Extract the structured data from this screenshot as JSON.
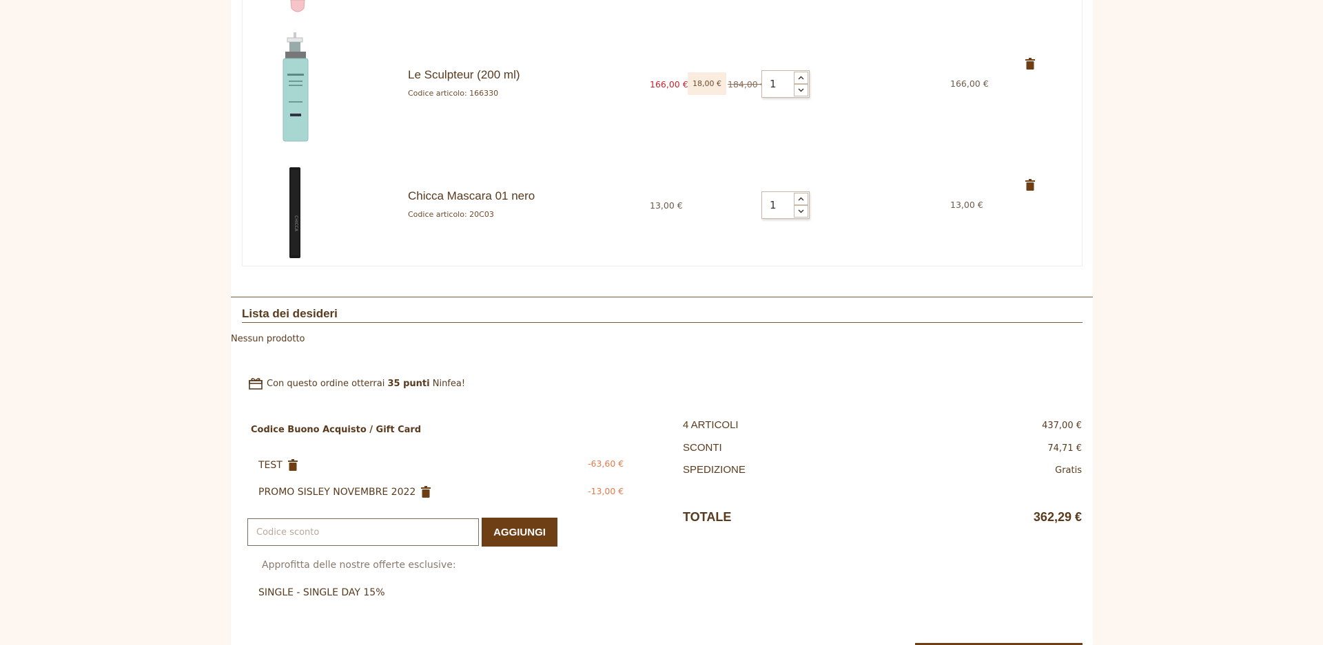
{
  "cart": {
    "items": [
      {
        "name": "Le Sculpteur (200 ml)",
        "code": "Codice articolo: 166330",
        "price_sale": "166,00 €",
        "discount": "18,00 €",
        "price_old": "184,00 €",
        "quantity": "1",
        "row_total": "166,00 €"
      },
      {
        "name": "Chicca Mascara 01 nero",
        "code": "Codice articolo: 20C03",
        "price": "13,00 €",
        "quantity": "1",
        "row_total": "13,00 €"
      }
    ]
  },
  "wishlist": {
    "title": "Lista dei desideri",
    "empty_text": "Nessun prodotto"
  },
  "points": {
    "prefix": "Con questo ordine otterrai",
    "value": "35 punti",
    "suffix": "Ninfea!"
  },
  "vouchers": {
    "title": "Codice Buono Acquisto / Gift Card",
    "applied": [
      {
        "name": "TEST",
        "amount": "-63,60 €"
      },
      {
        "name": "PROMO SISLEY NOVEMBRE 2022",
        "amount": "-13,00 €"
      }
    ],
    "input_placeholder": "Codice sconto",
    "add_label": "AGGIUNGI",
    "offers_hint": "Approfitta delle nostre offerte esclusive:",
    "offer": "SINGLE - SINGLE DAY 15%"
  },
  "summary": {
    "items_label": "4 ARTICOLI",
    "items_value": "437,00 €",
    "discounts_label": "SCONTI",
    "discounts_value": "74,71 €",
    "shipping_label": "SPEDIZIONE",
    "shipping_value": "Gratis",
    "total_label": "TOTALE",
    "total_value": "362,29 €"
  },
  "colors": {
    "brand_brown": "#6e3f14",
    "sale_red": "#c4232a",
    "voucher_orange": "#e07a4a",
    "page_bg": "#fdf6f1"
  }
}
